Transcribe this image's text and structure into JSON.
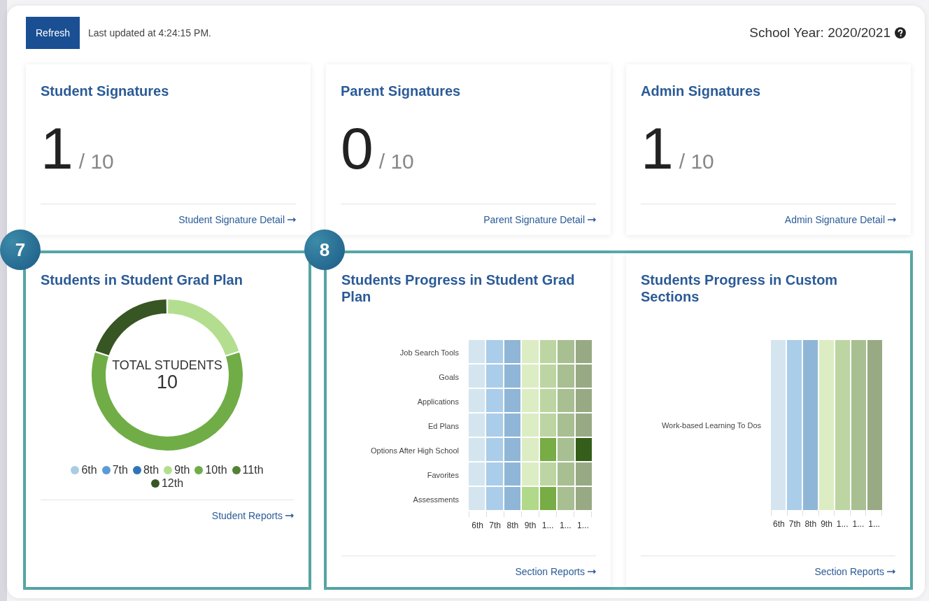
{
  "header": {
    "refresh_button": "Refresh",
    "last_updated": "Last updated at 4:24:15 PM.",
    "school_year": "School Year: 2020/2021"
  },
  "signature_cards": [
    {
      "title": "Student Signatures",
      "count": "1",
      "total": "/ 10",
      "link": "Student Signature Detail"
    },
    {
      "title": "Parent Signatures",
      "count": "0",
      "total": "/ 10",
      "link": "Parent Signature Detail"
    },
    {
      "title": "Admin Signatures",
      "count": "1",
      "total": "/ 10",
      "link": "Admin Signature Detail"
    }
  ],
  "highlights": [
    {
      "badge": "7"
    },
    {
      "badge": "8"
    }
  ],
  "grad_plan": {
    "title": "Students in Student Grad Plan",
    "center_label": "TOTAL STUDENTS",
    "center_value": "10",
    "chart_data": {
      "type": "donut",
      "categories": [
        "6th",
        "7th",
        "8th",
        "9th",
        "10th",
        "11th",
        "12th"
      ],
      "values": [
        0,
        0,
        0,
        20,
        60,
        0,
        20
      ]
    },
    "legend": [
      {
        "color": "#a9cce3"
      },
      {
        "color": "#5b9bd5"
      },
      {
        "color": "#2e75b6"
      },
      {
        "color": "#b3de8f"
      },
      {
        "color": "#70ad47"
      },
      {
        "color": "#548235"
      },
      {
        "color": "#375623"
      }
    ],
    "link": "Student Reports"
  },
  "progress_cards": [
    {
      "title": "Students Progress in Student Grad Plan",
      "columns": [
        "6th",
        "7th",
        "8th",
        "9th",
        "1...",
        "1...",
        "1..."
      ],
      "rows": [
        {
          "label": "Job Search Tools",
          "cells": [
            {
              "color": "#d4e5f0"
            },
            {
              "color": "#aacde9"
            },
            {
              "color": "#8fb6d6"
            },
            {
              "color": "#dcedc4"
            },
            {
              "color": "#bdd5a2"
            },
            {
              "color": "#a8bf91"
            },
            {
              "color": "#98aa84"
            }
          ]
        },
        {
          "label": "Goals",
          "cells": [
            {
              "color": "#d4e5f0"
            },
            {
              "color": "#aacde9"
            },
            {
              "color": "#8fb6d6"
            },
            {
              "color": "#dcedc4"
            },
            {
              "color": "#bdd5a2"
            },
            {
              "color": "#a8bf91"
            },
            {
              "color": "#98aa84"
            }
          ]
        },
        {
          "label": "Applications",
          "cells": [
            {
              "color": "#d4e5f0"
            },
            {
              "color": "#aacde9"
            },
            {
              "color": "#8fb6d6"
            },
            {
              "color": "#dcedc4"
            },
            {
              "color": "#bdd5a2"
            },
            {
              "color": "#a8bf91"
            },
            {
              "color": "#98aa84"
            }
          ]
        },
        {
          "label": "Ed Plans",
          "cells": [
            {
              "color": "#d4e5f0"
            },
            {
              "color": "#aacde9"
            },
            {
              "color": "#8fb6d6"
            },
            {
              "color": "#dcedc4"
            },
            {
              "color": "#bdd5a2"
            },
            {
              "color": "#a8bf91"
            },
            {
              "color": "#98aa84"
            }
          ]
        },
        {
          "label": "Options After High School",
          "cells": [
            {
              "color": "#d4e5f0"
            },
            {
              "color": "#aacde9"
            },
            {
              "color": "#8fb6d6"
            },
            {
              "color": "#dcedc4"
            },
            {
              "color": "#77ad44"
            },
            {
              "color": "#a8bf91"
            },
            {
              "color": "#355e1b"
            }
          ]
        },
        {
          "label": "Favorites",
          "cells": [
            {
              "color": "#d4e5f0"
            },
            {
              "color": "#aacde9"
            },
            {
              "color": "#8fb6d6"
            },
            {
              "color": "#dcedc4"
            },
            {
              "color": "#bdd5a2"
            },
            {
              "color": "#a8bf91"
            },
            {
              "color": "#98aa84"
            }
          ]
        },
        {
          "label": "Assessments",
          "cells": [
            {
              "color": "#d4e5f0"
            },
            {
              "color": "#aacde9"
            },
            {
              "color": "#8fb6d6"
            },
            {
              "color": "#b0d98a"
            },
            {
              "color": "#77ad44"
            },
            {
              "color": "#a8bf91"
            },
            {
              "color": "#98aa84"
            }
          ]
        }
      ],
      "link": "Section Reports"
    },
    {
      "title": "Students Progress in Custom Sections",
      "columns": [
        "6th",
        "7th",
        "8th",
        "9th",
        "1...",
        "1...",
        "1..."
      ],
      "rows": [
        {
          "label": "Work-based Learning To Dos",
          "cells": [
            {
              "color": "#d4e5f0"
            },
            {
              "color": "#aacde9"
            },
            {
              "color": "#8fb6d6"
            },
            {
              "color": "#dcedc4"
            },
            {
              "color": "#bdd5a2"
            },
            {
              "color": "#a8bf91"
            },
            {
              "color": "#98aa84"
            }
          ]
        }
      ],
      "link": "Section Reports"
    }
  ]
}
